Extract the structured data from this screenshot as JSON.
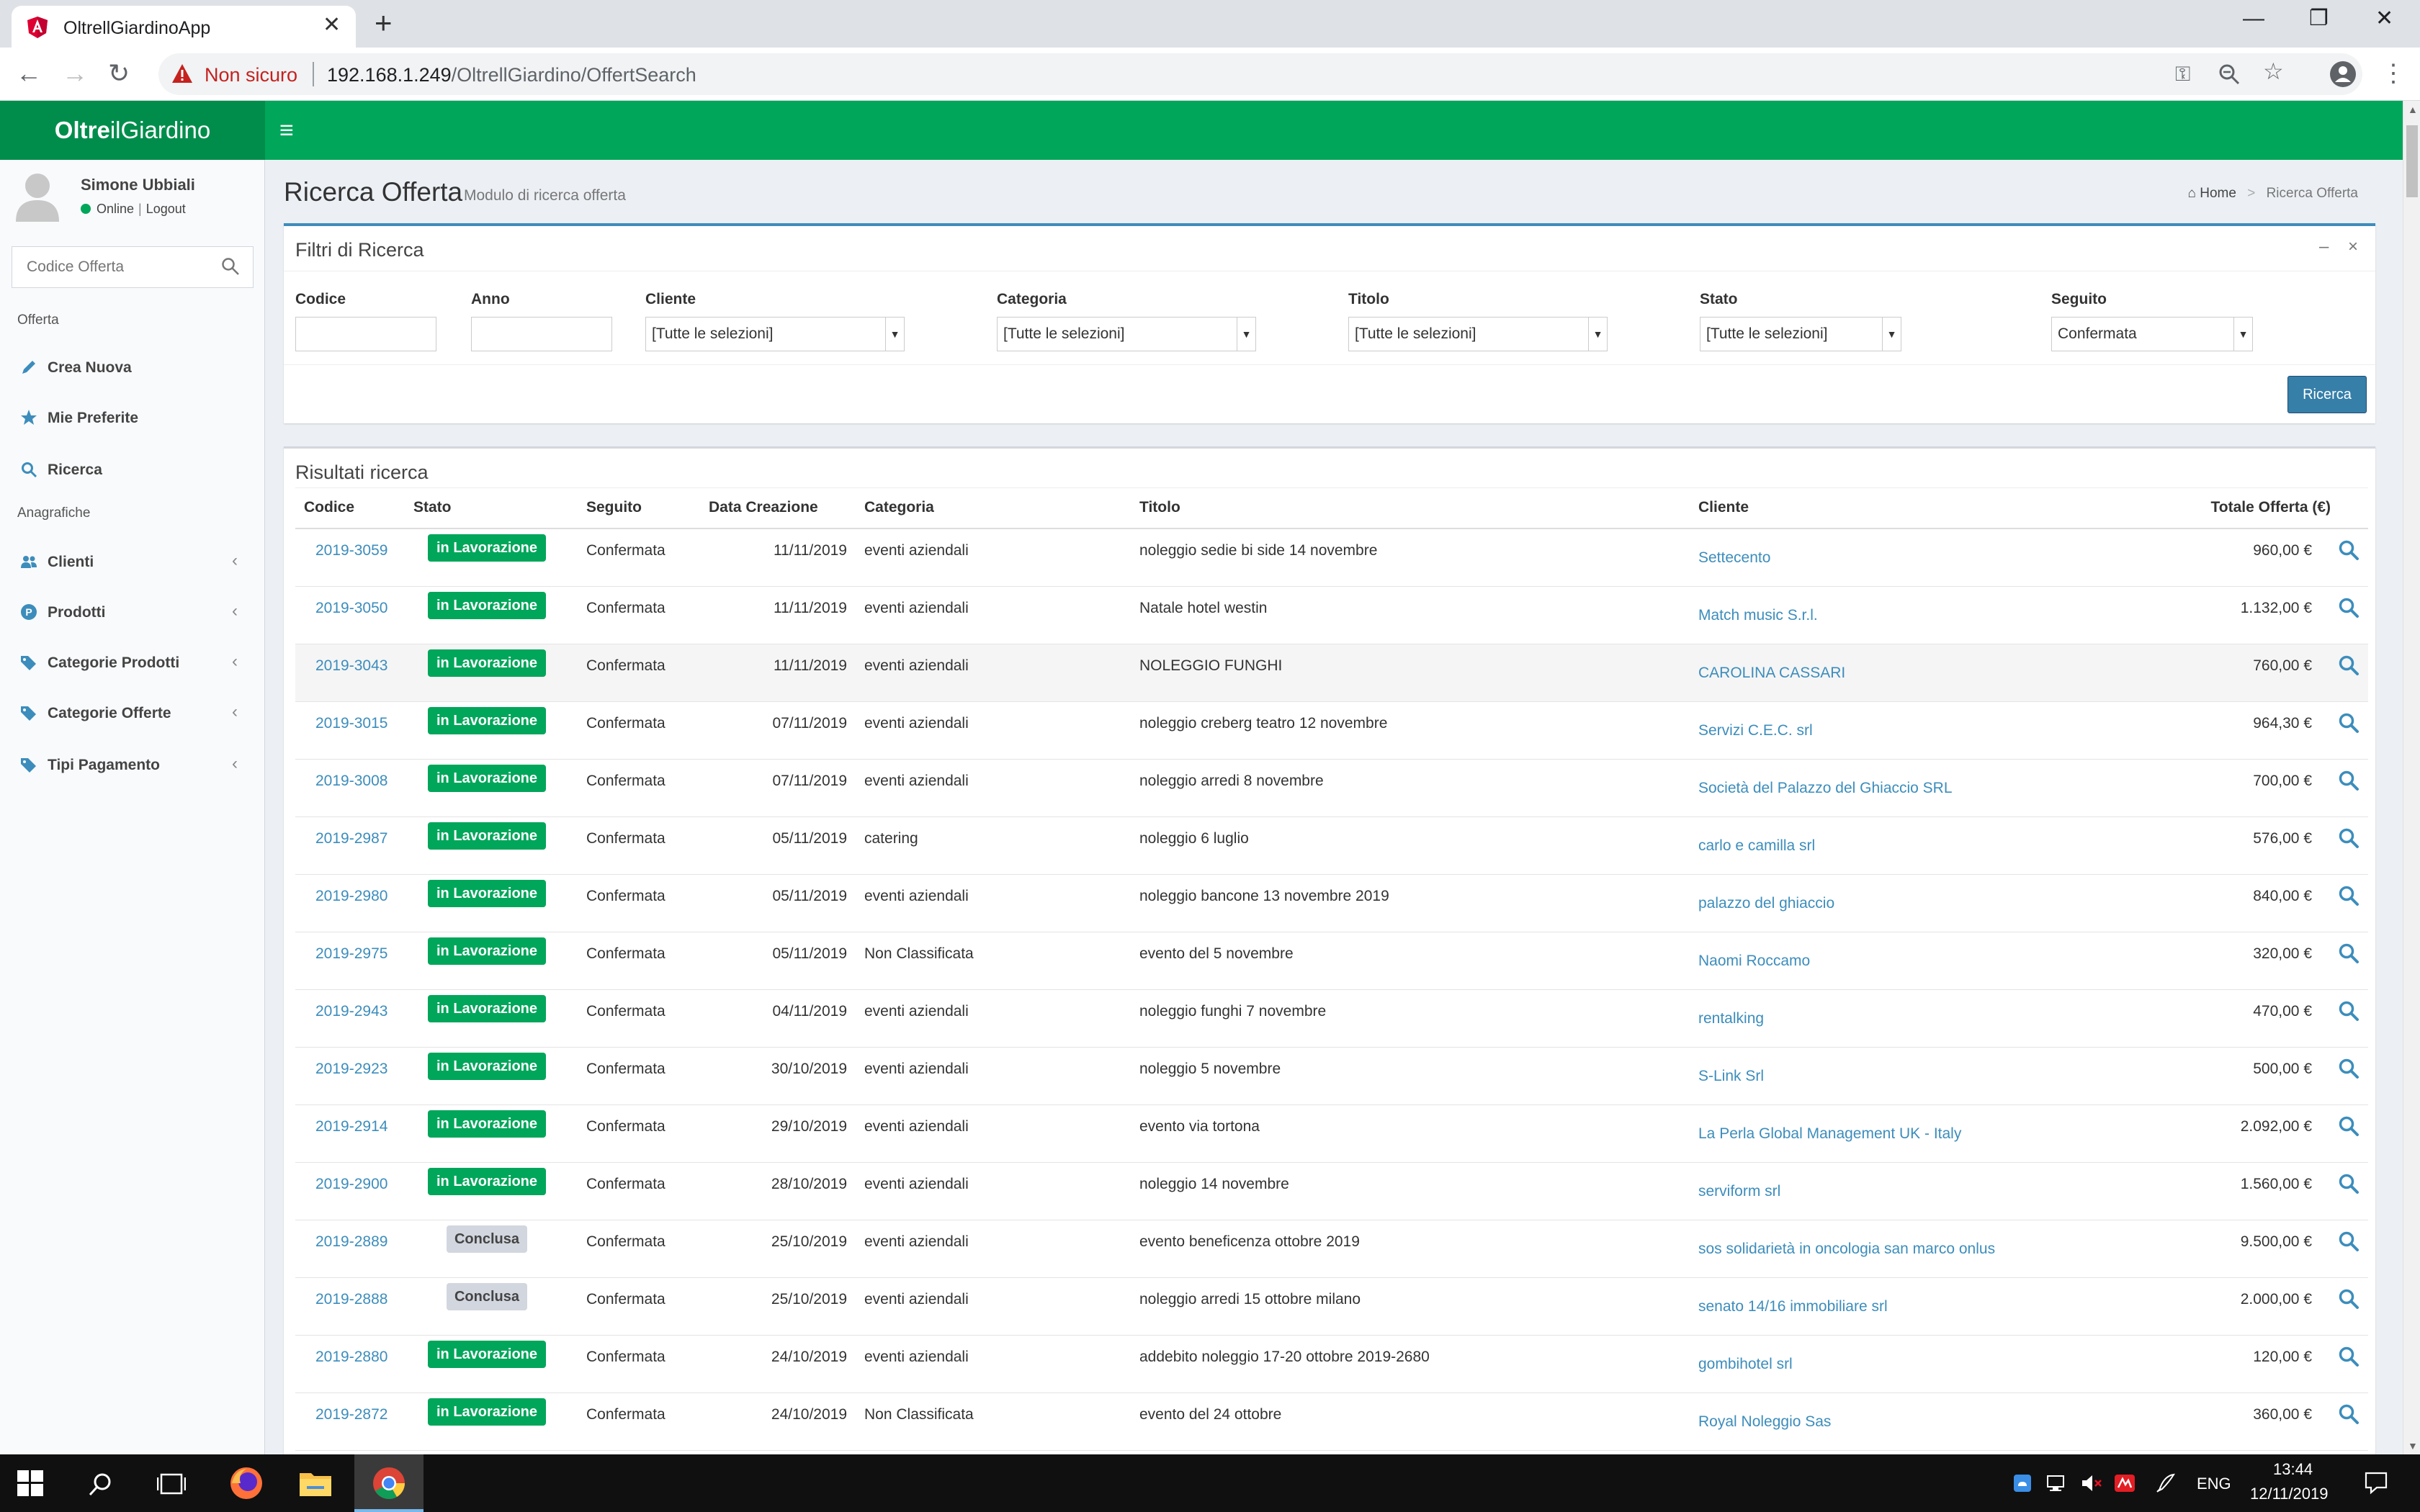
{
  "browser": {
    "tab_title": "OltrellGiardinoApp",
    "tab_close": "✕",
    "new_tab": "+",
    "minimize": "—",
    "restore": "❐",
    "close": "✕",
    "security_label": "Non sicuro",
    "url_host": "192.168.1.249",
    "url_path": "/OltrellGiardino/OffertSearch"
  },
  "app": {
    "logo_bold": "Oltre",
    "logo_rest": "ilGiardino",
    "hamburger": "≡"
  },
  "user": {
    "name": "Simone Ubbiali",
    "status": "Online",
    "separator": "|",
    "logout": "Logout"
  },
  "sidebar": {
    "search_placeholder": "Codice Offerta",
    "section_offerta": "Offerta",
    "section_anagrafiche": "Anagrafiche",
    "chevron": "‹",
    "items": [
      {
        "label": "Crea Nuova",
        "icon": "pencil-icon"
      },
      {
        "label": "Mie Preferite",
        "icon": "star-icon"
      },
      {
        "label": "Ricerca",
        "icon": "search-icon"
      },
      {
        "label": "Clienti",
        "icon": "users-icon"
      },
      {
        "label": "Prodotti",
        "icon": "product-icon"
      },
      {
        "label": "Categorie Prodotti",
        "icon": "tags-icon"
      },
      {
        "label": "Categorie Offerte",
        "icon": "tags-icon"
      },
      {
        "label": "Tipi Pagamento",
        "icon": "tags-icon"
      }
    ]
  },
  "page": {
    "title": "Ricerca Offerta",
    "subtitle": "Modulo di ricerca offerta",
    "breadcrumb_home": "Home",
    "breadcrumb_sep": ">",
    "breadcrumb_current": "Ricerca Offerta"
  },
  "filters": {
    "title": "Filtri di Ricerca",
    "collapse": "–",
    "remove": "×",
    "codice_label": "Codice",
    "anno_label": "Anno",
    "cliente_label": "Cliente",
    "cliente_value": "[Tutte le selezioni]",
    "categoria_label": "Categoria",
    "categoria_value": "[Tutte le selezioni]",
    "titolo_label": "Titolo",
    "titolo_value": "[Tutte le selezioni]",
    "stato_label": "Stato",
    "stato_value": "[Tutte le selezioni]",
    "seguito_label": "Seguito",
    "seguito_value": "Confermata",
    "arrow": "▼",
    "search_button": "Ricerca"
  },
  "results": {
    "title": "Risultati ricerca",
    "columns": {
      "codice": "Codice",
      "stato": "Stato",
      "seguito": "Seguito",
      "data": "Data Creazione",
      "categoria": "Categoria",
      "titolo": "Titolo",
      "cliente": "Cliente",
      "totale": "Totale Offerta (€)"
    },
    "rows": [
      {
        "codice": "2019-3059",
        "stato": "in Lavorazione",
        "seguito": "Confermata",
        "data": "11/11/2019",
        "categoria": "eventi aziendali",
        "titolo": "noleggio sedie bi side 14 novembre",
        "cliente": "Settecento",
        "totale": "960,00 €"
      },
      {
        "codice": "2019-3050",
        "stato": "in Lavorazione",
        "seguito": "Confermata",
        "data": "11/11/2019",
        "categoria": "eventi aziendali",
        "titolo": "Natale hotel westin",
        "cliente": "Match music S.r.l.",
        "totale": "1.132,00 €"
      },
      {
        "codice": "2019-3043",
        "stato": "in Lavorazione",
        "seguito": "Confermata",
        "data": "11/11/2019",
        "categoria": "eventi aziendali",
        "titolo": "NOLEGGIO FUNGHI",
        "cliente": "CAROLINA CASSARI",
        "totale": "760,00 €"
      },
      {
        "codice": "2019-3015",
        "stato": "in Lavorazione",
        "seguito": "Confermata",
        "data": "07/11/2019",
        "categoria": "eventi aziendali",
        "titolo": "noleggio creberg teatro 12 novembre",
        "cliente": "Servizi C.E.C. srl",
        "totale": "964,30 €"
      },
      {
        "codice": "2019-3008",
        "stato": "in Lavorazione",
        "seguito": "Confermata",
        "data": "07/11/2019",
        "categoria": "eventi aziendali",
        "titolo": "noleggio arredi 8 novembre",
        "cliente": "Società del Palazzo del Ghiaccio SRL",
        "totale": "700,00 €"
      },
      {
        "codice": "2019-2987",
        "stato": "in Lavorazione",
        "seguito": "Confermata",
        "data": "05/11/2019",
        "categoria": "catering",
        "titolo": "noleggio 6 luglio",
        "cliente": "carlo e camilla srl",
        "totale": "576,00 €"
      },
      {
        "codice": "2019-2980",
        "stato": "in Lavorazione",
        "seguito": "Confermata",
        "data": "05/11/2019",
        "categoria": "eventi aziendali",
        "titolo": "noleggio bancone 13 novembre 2019",
        "cliente": "palazzo del ghiaccio",
        "totale": "840,00 €"
      },
      {
        "codice": "2019-2975",
        "stato": "in Lavorazione",
        "seguito": "Confermata",
        "data": "05/11/2019",
        "categoria": "Non Classificata",
        "titolo": "evento del 5 novembre",
        "cliente": "Naomi Roccamo",
        "totale": "320,00 €"
      },
      {
        "codice": "2019-2943",
        "stato": "in Lavorazione",
        "seguito": "Confermata",
        "data": "04/11/2019",
        "categoria": "eventi aziendali",
        "titolo": "noleggio funghi 7 novembre",
        "cliente": "rentalking",
        "totale": "470,00 €"
      },
      {
        "codice": "2019-2923",
        "stato": "in Lavorazione",
        "seguito": "Confermata",
        "data": "30/10/2019",
        "categoria": "eventi aziendali",
        "titolo": "noleggio 5 novembre",
        "cliente": "S-Link Srl",
        "totale": "500,00 €"
      },
      {
        "codice": "2019-2914",
        "stato": "in Lavorazione",
        "seguito": "Confermata",
        "data": "29/10/2019",
        "categoria": "eventi aziendali",
        "titolo": "evento via tortona",
        "cliente": "La Perla Global Management UK - Italy",
        "totale": "2.092,00 €"
      },
      {
        "codice": "2019-2900",
        "stato": "in Lavorazione",
        "seguito": "Confermata",
        "data": "28/10/2019",
        "categoria": "eventi aziendali",
        "titolo": "noleggio 14 novembre",
        "cliente": "serviform srl",
        "totale": "1.560,00 €"
      },
      {
        "codice": "2019-2889",
        "stato": "Conclusa",
        "seguito": "Confermata",
        "data": "25/10/2019",
        "categoria": "eventi aziendali",
        "titolo": "evento beneficenza ottobre 2019",
        "cliente": "sos solidarietà in oncologia san marco onlus",
        "totale": "9.500,00 €"
      },
      {
        "codice": "2019-2888",
        "stato": "Conclusa",
        "seguito": "Confermata",
        "data": "25/10/2019",
        "categoria": "eventi aziendali",
        "titolo": "noleggio arredi 15 ottobre milano",
        "cliente": "senato 14/16 immobiliare srl",
        "totale": "2.000,00 €"
      },
      {
        "codice": "2019-2880",
        "stato": "in Lavorazione",
        "seguito": "Confermata",
        "data": "24/10/2019",
        "categoria": "eventi aziendali",
        "titolo": "addebito noleggio 17-20 ottobre 2019-2680",
        "cliente": "gombihotel srl",
        "totale": "120,00 €"
      },
      {
        "codice": "2019-2872",
        "stato": "in Lavorazione",
        "seguito": "Confermata",
        "data": "24/10/2019",
        "categoria": "Non Classificata",
        "titolo": "evento del 24 ottobre",
        "cliente": "Royal Noleggio Sas",
        "totale": "360,00 €"
      }
    ]
  },
  "taskbar": {
    "lang": "ENG",
    "time": "13:44",
    "date": "12/11/2019"
  },
  "colors": {
    "header_green": "#00a65a",
    "logo_green": "#008d4c",
    "link_blue": "#3c8dbc",
    "button_blue": "#367fa9",
    "badge_gray": "#d2d6de"
  }
}
